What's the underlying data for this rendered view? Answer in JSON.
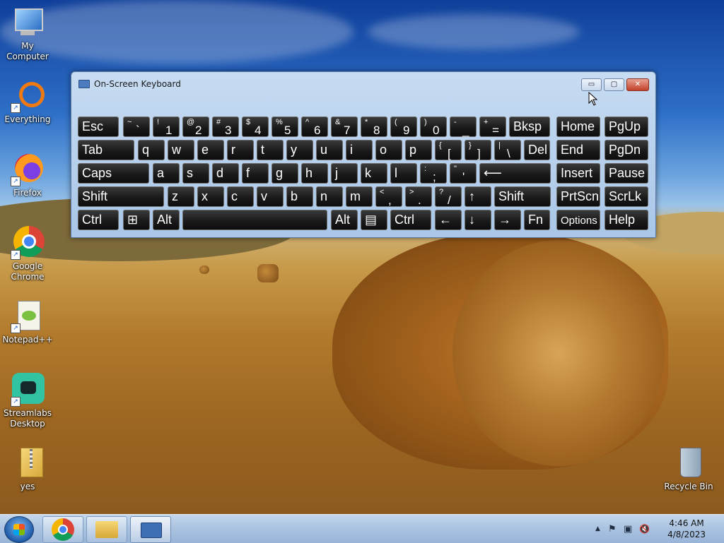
{
  "desktop_icons": [
    {
      "label": "My Computer",
      "icon": "computer-icon"
    },
    {
      "label": "Everything",
      "icon": "everything-search-icon"
    },
    {
      "label": "Firefox",
      "icon": "firefox-icon"
    },
    {
      "label": "Google Chrome",
      "icon": "chrome-icon"
    },
    {
      "label": "Notepad++",
      "icon": "notepadpp-icon"
    },
    {
      "label": "Streamlabs Desktop",
      "icon": "streamlabs-icon"
    },
    {
      "label": "yes",
      "icon": "zip-folder-icon"
    },
    {
      "label": "Recycle Bin",
      "icon": "recycle-bin-icon"
    }
  ],
  "osk": {
    "title": "On-Screen Keyboard",
    "minimize": "▭",
    "maximize": "▢",
    "close": "✕",
    "rows": [
      [
        {
          "label": "Esc"
        },
        {
          "top": "~",
          "main": "`"
        },
        {
          "top": "!",
          "main": "1"
        },
        {
          "top": "@",
          "main": "2"
        },
        {
          "top": "#",
          "main": "3"
        },
        {
          "top": "$",
          "main": "4"
        },
        {
          "top": "%",
          "main": "5"
        },
        {
          "top": "^",
          "main": "6"
        },
        {
          "top": "&",
          "main": "7"
        },
        {
          "top": "*",
          "main": "8"
        },
        {
          "top": "(",
          "main": "9"
        },
        {
          "top": ")",
          "main": "0"
        },
        {
          "top": "-",
          "main": "_"
        },
        {
          "top": "+",
          "main": "="
        },
        {
          "label": "Bksp"
        },
        {
          "label": "Home"
        },
        {
          "label": "PgUp"
        }
      ],
      [
        {
          "label": "Tab"
        },
        {
          "label": "q"
        },
        {
          "label": "w"
        },
        {
          "label": "e"
        },
        {
          "label": "r"
        },
        {
          "label": "t"
        },
        {
          "label": "y"
        },
        {
          "label": "u"
        },
        {
          "label": "i"
        },
        {
          "label": "o"
        },
        {
          "label": "p"
        },
        {
          "top": "{",
          "main": "["
        },
        {
          "top": "}",
          "main": "]"
        },
        {
          "top": "|",
          "main": "\\"
        },
        {
          "label": "Del"
        },
        {
          "label": "End"
        },
        {
          "label": "PgDn"
        }
      ],
      [
        {
          "label": "Caps"
        },
        {
          "label": "a"
        },
        {
          "label": "s"
        },
        {
          "label": "d"
        },
        {
          "label": "f"
        },
        {
          "label": "g"
        },
        {
          "label": "h"
        },
        {
          "label": "j"
        },
        {
          "label": "k"
        },
        {
          "label": "l"
        },
        {
          "top": ":",
          "main": ";"
        },
        {
          "top": "\"",
          "main": "'"
        },
        {
          "label": "⟵"
        },
        {
          "label": "Insert"
        },
        {
          "label": "Pause"
        }
      ],
      [
        {
          "label": "Shift"
        },
        {
          "label": "z"
        },
        {
          "label": "x"
        },
        {
          "label": "c"
        },
        {
          "label": "v"
        },
        {
          "label": "b"
        },
        {
          "label": "n"
        },
        {
          "label": "m"
        },
        {
          "top": "<",
          "main": ","
        },
        {
          "top": ">",
          "main": "."
        },
        {
          "top": "?",
          "main": "/"
        },
        {
          "label": "↑"
        },
        {
          "label": "Shift"
        },
        {
          "label": "PrtScn"
        },
        {
          "label": "ScrLk"
        }
      ],
      [
        {
          "label": "Ctrl"
        },
        {
          "label": "⊞"
        },
        {
          "label": "Alt"
        },
        {
          "label": ""
        },
        {
          "label": "Alt"
        },
        {
          "label": "▤"
        },
        {
          "label": "Ctrl"
        },
        {
          "label": "←"
        },
        {
          "label": "↓"
        },
        {
          "label": "→"
        },
        {
          "label": "Fn"
        },
        {
          "label": "Options"
        },
        {
          "label": "Help"
        }
      ]
    ]
  },
  "taskbar": {
    "items": [
      {
        "icon": "start-orb-icon"
      },
      {
        "icon": "chrome-icon"
      },
      {
        "icon": "file-explorer-icon"
      },
      {
        "icon": "on-screen-keyboard-icon"
      }
    ],
    "tray": {
      "show_hidden": "▲",
      "flag": "⚑",
      "network": "▣",
      "volume": "🔇",
      "time": "4:46 AM",
      "date": "4/8/2023"
    }
  }
}
